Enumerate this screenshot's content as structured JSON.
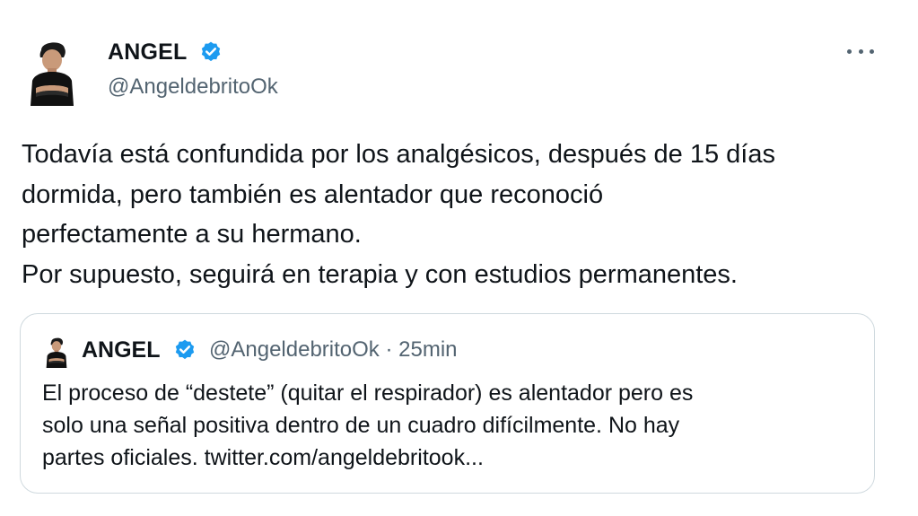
{
  "tweet": {
    "author_name": "ANGEL",
    "handle": "@AngeldebritoOk",
    "more_icon": "more-horizontal-icon",
    "verified_icon": "verified-badge-icon",
    "body_lines": [
      "Todavía está confundida por los analgésicos, después de 15 días",
      "dormida, pero también es alentador que reconoció",
      "perfectamente a su hermano.",
      "Por supuesto, seguirá en terapia y con estudios permanentes."
    ]
  },
  "quote": {
    "author_name": "ANGEL",
    "handle_time": "@AngeldebritoOk · 25min",
    "text_lines": [
      "El proceso de “destete” (quitar el respirador) es alentador pero es",
      "solo una señal positiva dentro de un cuadro difícilmente. No hay",
      "partes oficiales. twitter.com/angeldebritook..."
    ]
  },
  "colors": {
    "text": "#0f1419",
    "secondary": "#536471",
    "verified": "#1d9bf0",
    "border": "#cfd9de"
  }
}
